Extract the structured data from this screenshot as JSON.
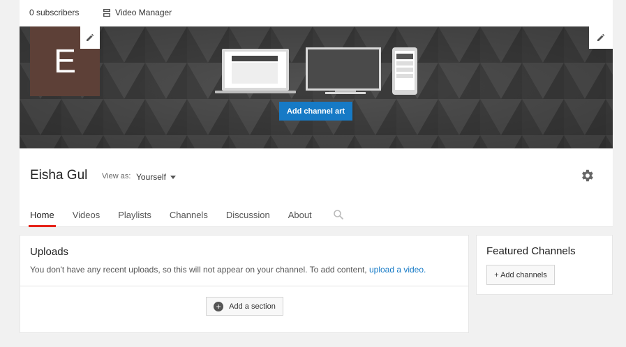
{
  "top": {
    "subscribers": "0 subscribers",
    "video_manager": "Video Manager"
  },
  "banner": {
    "avatar_letter": "E",
    "avatar_color": "#5d4037",
    "add_channel_art": "Add channel art",
    "accent": "#167ac6"
  },
  "header": {
    "channel_name": "Eisha Gul",
    "view_as_label": "View as:",
    "view_as_value": "Yourself",
    "tabs": [
      "Home",
      "Videos",
      "Playlists",
      "Channels",
      "Discussion",
      "About"
    ],
    "active_tab": "Home",
    "active_color": "#e62117"
  },
  "uploads": {
    "title": "Uploads",
    "message": "You don't have any recent uploads, so this will not appear on your channel. To add content,",
    "link": "upload a video.",
    "add_section": "Add a section"
  },
  "featured": {
    "title": "Featured Channels",
    "add_channels": "+ Add channels"
  }
}
